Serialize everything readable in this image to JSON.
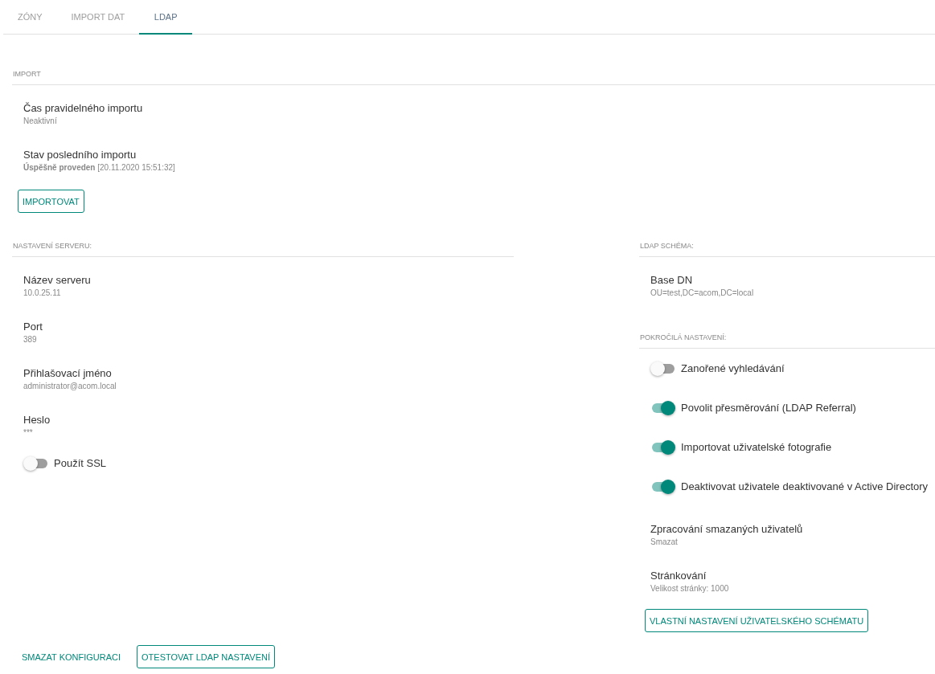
{
  "tabs": [
    {
      "label": "ZÓNY",
      "selected": false
    },
    {
      "label": "IMPORT DAT",
      "selected": false
    },
    {
      "label": "LDAP",
      "selected": true
    }
  ],
  "import": {
    "heading": "IMPORT",
    "items": [
      {
        "kind": "field",
        "title": "Čas pravidelného importu",
        "value": "Neaktivní"
      },
      {
        "kind": "field",
        "title": "Stav posledního importu",
        "value": "**Úspěšně proveden** [20.11.2020 15:51:32]"
      }
    ],
    "button": "IMPORTOVAT"
  },
  "server": {
    "heading": "NASTAVENÍ SERVERU:",
    "items": [
      {
        "kind": "field",
        "title": "Název serveru",
        "value": "10.0.25.11"
      },
      {
        "kind": "field",
        "title": "Port",
        "value": "389"
      },
      {
        "kind": "field",
        "title": "Přihlašovací jméno",
        "value": "administrator@acom.local"
      },
      {
        "kind": "field",
        "title": "Heslo",
        "value": "***"
      },
      {
        "kind": "toggle",
        "title": "Použít SSL",
        "on": false
      }
    ]
  },
  "schema": {
    "heading": "LDAP SCHÉMA:",
    "items": [
      {
        "kind": "field",
        "title": "Base DN",
        "value": "OU=test,DC=acom,DC=local"
      }
    ]
  },
  "advanced": {
    "heading": "POKROČILÁ NASTAVENÍ:",
    "items": [
      {
        "kind": "toggle",
        "title": "Zanořené vyhledávání",
        "on": false
      },
      {
        "kind": "toggle",
        "title": "Povolit přesměrování (LDAP Referral)",
        "on": true
      },
      {
        "kind": "toggle",
        "title": "Importovat uživatelské fotografie",
        "on": true
      },
      {
        "kind": "toggle",
        "title": "Deaktivovat uživatele deaktivované v Active Directory",
        "on": true
      },
      {
        "kind": "field",
        "title": "Zpracování smazaných uživatelů",
        "value": "Smazat"
      },
      {
        "kind": "field",
        "title": "Stránkování",
        "value": "Velikost stránky: 1000"
      }
    ],
    "button": "VLASTNÍ NASTAVENÍ UŽIVATELSKÉHO SCHÉMATU"
  },
  "footer": [
    {
      "kind": "text",
      "label": "SMAZAT KONFIGURACI"
    },
    {
      "kind": "outlined",
      "label": "OTESTOVAT LDAP NASTAVENÍ"
    }
  ]
}
